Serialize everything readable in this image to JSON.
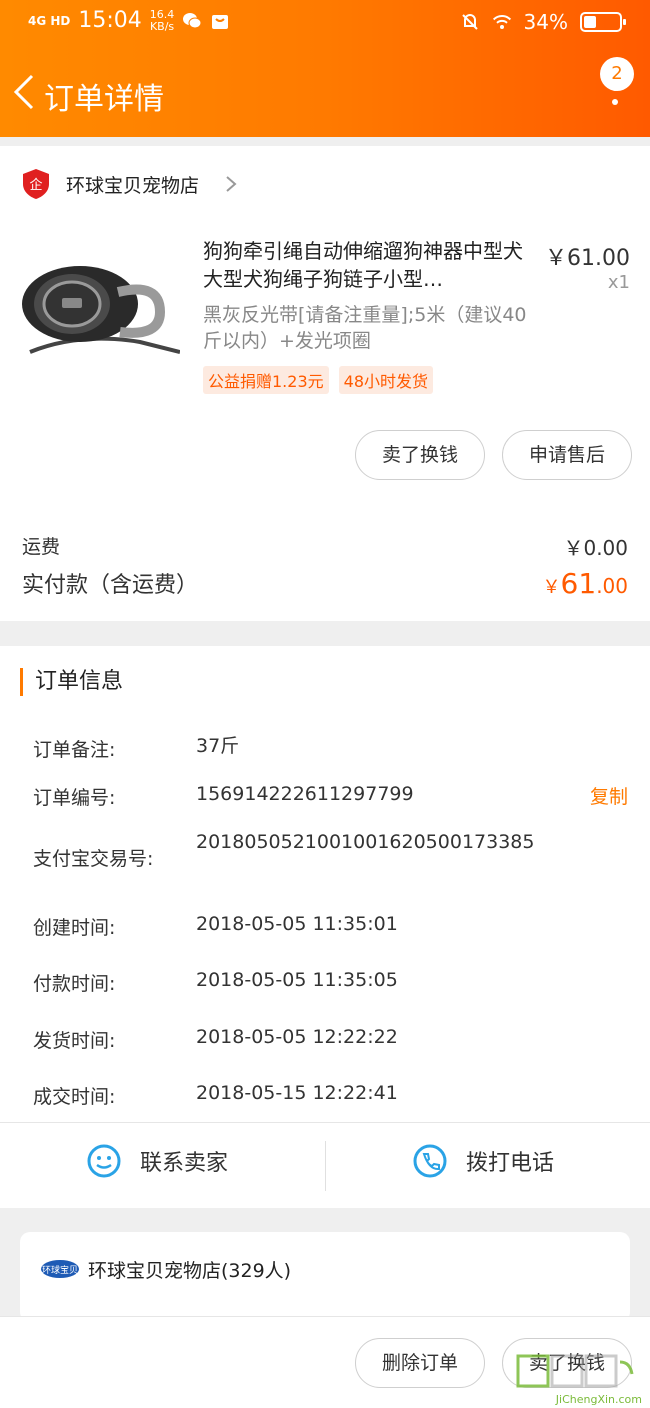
{
  "status_bar": {
    "network": "4G HD",
    "time": "15:04",
    "speed": "16.4",
    "speed_unit": "KB/s",
    "battery": "34%"
  },
  "nav": {
    "title": "订单详情",
    "badge_count": "2"
  },
  "shop": {
    "name": "环球宝贝宠物店"
  },
  "product": {
    "title": "狗狗牵引绳自动伸缩遛狗神器中型犬大型犬狗绳子狗链子小型…",
    "price": "￥61.00",
    "qty": "x1",
    "spec": "黑灰反光带[请备注重量];5米（建议40斤以内）+发光项圈",
    "tags": [
      "公益捐赠1.23元",
      "48小时发货"
    ]
  },
  "item_actions": {
    "sell": "卖了换钱",
    "after_sale": "申请售后"
  },
  "fees": {
    "shipping_label": "运费",
    "shipping_value": "￥0.00",
    "paid_label": "实付款（含运费）",
    "paid_currency": "￥",
    "paid_int": "61",
    "paid_dec": ".00"
  },
  "order_info": {
    "title": "订单信息",
    "copy_label": "复制",
    "rows": [
      {
        "label": "订单备注:",
        "value": "37斤"
      },
      {
        "label": "订单编号:",
        "value": "156914222611297799"
      },
      {
        "label": "支付宝交易号:",
        "value": "2018050521001001620500173385"
      },
      {
        "label": "创建时间:",
        "value": "2018-05-05 11:35:01"
      },
      {
        "label": "付款时间:",
        "value": "2018-05-05 11:35:05"
      },
      {
        "label": "发货时间:",
        "value": "2018-05-05 12:22:22"
      },
      {
        "label": "成交时间:",
        "value": "2018-05-15 12:22:41"
      }
    ]
  },
  "contact": {
    "seller": "联系卖家",
    "call": "拨打电话"
  },
  "shop_card": {
    "name": "环球宝贝宠物店(329人)",
    "logo_text": "环球宝贝"
  },
  "bottom_bar": {
    "delete": "删除订单",
    "sell": "卖了换钱"
  },
  "watermark": "JiChengXin.com",
  "colors": {
    "accent": "#ff7a00",
    "price": "#ff5a00",
    "link_blue": "#2aa3e6"
  }
}
